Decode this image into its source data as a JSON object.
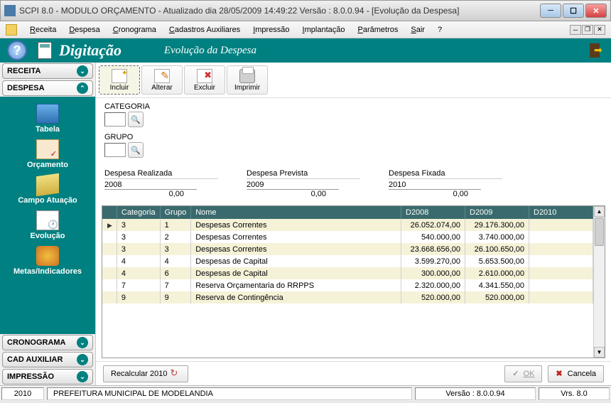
{
  "window": {
    "title": "SCPI 8.0 - MODULO ORÇAMENTO - Atualizado dia 28/05/2009 14:49:22   Versão : 8.0.0.94 - [Evolução da Despesa]"
  },
  "menu": {
    "items": [
      "Receita",
      "Despesa",
      "Cronograma",
      "Cadastros Auxiliares",
      "Impressão",
      "Implantação",
      "Parâmetros",
      "Sair",
      "?"
    ]
  },
  "header": {
    "title": "Digitação",
    "subtitle": "Evolução da Despesa"
  },
  "sidebar": {
    "sections": [
      {
        "label": "RECEITA",
        "expanded": false
      },
      {
        "label": "DESPESA",
        "expanded": true,
        "items": [
          {
            "label": "Tabela",
            "icon": "tabela"
          },
          {
            "label": "Orçamento",
            "icon": "orcamento"
          },
          {
            "label": "Campo Atuação",
            "icon": "campo"
          },
          {
            "label": "Evolução",
            "icon": "evolucao"
          },
          {
            "label": "Metas/Indicadores",
            "icon": "metas"
          }
        ]
      },
      {
        "label": "CRONOGRAMA",
        "expanded": false
      },
      {
        "label": "CAD AUXILIAR",
        "expanded": false
      },
      {
        "label": "IMPRESSÃO",
        "expanded": false
      }
    ]
  },
  "toolbar": {
    "buttons": [
      {
        "label": "Incluir",
        "icon": "incluir",
        "active": true
      },
      {
        "label": "Alterar",
        "icon": "alterar"
      },
      {
        "label": "Excluir",
        "icon": "excluir"
      },
      {
        "label": "Imprimir",
        "icon": "imprimir"
      }
    ]
  },
  "filters": {
    "categoria_label": "CATEGORIA",
    "categoria_value": "",
    "grupo_label": "GRUPO",
    "grupo_value": ""
  },
  "despesa": {
    "realizada": {
      "title": "Despesa Realizada",
      "year": "2008",
      "value": "0,00"
    },
    "prevista": {
      "title": "Despesa Prevista",
      "year": "2009",
      "value": "0,00"
    },
    "fixada": {
      "title": "Despesa Fixada",
      "year": "2010",
      "value": "0,00"
    }
  },
  "grid": {
    "columns": [
      "Categoria",
      "Grupo",
      "Nome",
      "D2008",
      "D2009",
      "D2010"
    ],
    "rows": [
      {
        "cat": "3",
        "grp": "1",
        "nome": "Despesas Correntes",
        "d2008": "26.052.074,00",
        "d2009": "29.176.300,00",
        "d2010": ""
      },
      {
        "cat": "3",
        "grp": "2",
        "nome": "Despesas Correntes",
        "d2008": "540.000,00",
        "d2009": "3.740.000,00",
        "d2010": ""
      },
      {
        "cat": "3",
        "grp": "3",
        "nome": "Despesas Correntes",
        "d2008": "23.668.656,00",
        "d2009": "26.100.650,00",
        "d2010": ""
      },
      {
        "cat": "4",
        "grp": "4",
        "nome": "Despesas de Capital",
        "d2008": "3.599.270,00",
        "d2009": "5.653.500,00",
        "d2010": ""
      },
      {
        "cat": "4",
        "grp": "6",
        "nome": "Despesas de Capital",
        "d2008": "300.000,00",
        "d2009": "2.610.000,00",
        "d2010": ""
      },
      {
        "cat": "7",
        "grp": "7",
        "nome": "Reserva Orçamentaria do RRPPS",
        "d2008": "2.320.000,00",
        "d2009": "4.341.550,00",
        "d2010": ""
      },
      {
        "cat": "9",
        "grp": "9",
        "nome": "Reserva de Contingência",
        "d2008": "520.000,00",
        "d2009": "520.000,00",
        "d2010": ""
      }
    ]
  },
  "buttons": {
    "recalcular": "Recalcular 2010",
    "ok": "OK",
    "cancela": "Cancela"
  },
  "status": {
    "year": "2010",
    "entity": "PREFEITURA MUNICIPAL DE MODELANDIA",
    "version": "Versão : 8.0.0.94",
    "vrs": "Vrs. 8.0"
  }
}
